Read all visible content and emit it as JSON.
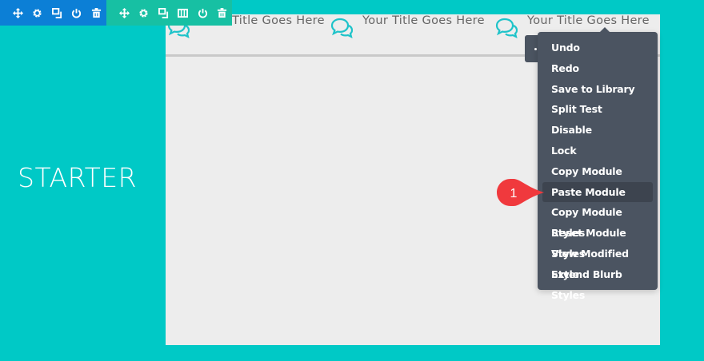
{
  "section_label": "STARTER",
  "blurbs": [
    {
      "title": "Your Title Goes Here"
    },
    {
      "title": "Your Title Goes Here"
    },
    {
      "title": "Your Title Goes Here"
    }
  ],
  "section_toolbar": [
    "move-icon",
    "gear-icon",
    "duplicate-icon",
    "power-icon",
    "trash-icon"
  ],
  "row_toolbar": [
    "move-icon",
    "gear-icon",
    "duplicate-icon",
    "columns-icon",
    "power-icon",
    "trash-icon"
  ],
  "context_menu": {
    "items": [
      "Undo",
      "Redo",
      "Save to Library",
      "Split Test",
      "Disable",
      "Lock",
      "Copy Module",
      "Paste Module",
      "Copy Module Styles",
      "Reset Module Styles",
      "View Modified Style",
      "Extend Blurb Styles"
    ],
    "active_index": 7
  },
  "callout": {
    "number": "1",
    "color": "#f0393d"
  },
  "colors": {
    "background": "#00c9c6",
    "section_toolbar": "#0c7fd6",
    "row_toolbar": "#17c0a3",
    "menu": "#4b5461"
  }
}
